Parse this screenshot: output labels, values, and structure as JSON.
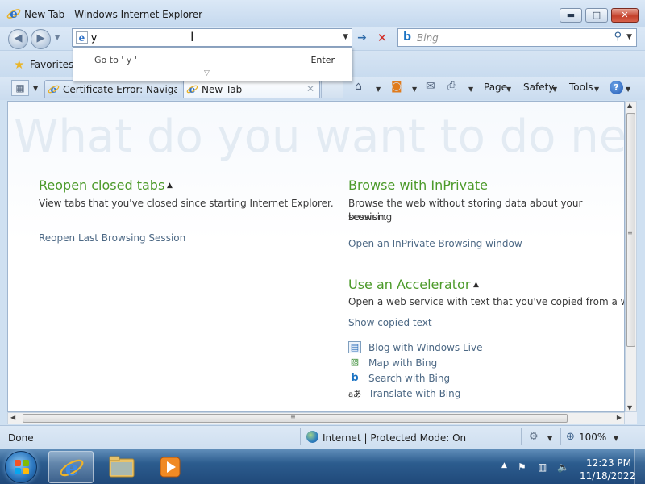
{
  "window": {
    "title": "New Tab - Windows Internet Explorer",
    "minimize_glyph": "▬",
    "maximize_glyph": "□",
    "close_glyph": "✕"
  },
  "navigation": {
    "back_glyph": "◀",
    "forward_glyph": "▶",
    "dropdown_glyph": "▼"
  },
  "address_bar": {
    "value": "y",
    "dropdown_glyph": "▼",
    "go_glyph": "➔",
    "stop_glyph": "✕"
  },
  "autocomplete": {
    "goto_text": "Go to ' y '",
    "enter_label": "Enter",
    "expand_glyph": "▽"
  },
  "search_box": {
    "placeholder": "Bing",
    "provider_glyph": "b",
    "search_glyph": "⚲",
    "dropdown_glyph": "▼"
  },
  "favorites": {
    "label": "Favorites",
    "star_glyph": "★"
  },
  "tabs": [
    {
      "label": "Certificate Error: Navigati...",
      "active": false
    },
    {
      "label": "New Tab",
      "active": true,
      "close_glyph": "✕"
    }
  ],
  "command_bar": {
    "quick_tabs_glyph": "▦",
    "home_glyph": "⌂",
    "feeds_glyph": "◙",
    "mail_glyph": "✉",
    "print_glyph": "⎙",
    "page_label": "Page",
    "safety_label": "Safety",
    "tools_label": "Tools",
    "help_glyph": "?",
    "dropdown_glyph": "▼"
  },
  "new_tab_page": {
    "hero": "What do you want to do next?",
    "reopen": {
      "title": "Reopen closed tabs",
      "toggle_glyph": "▲",
      "description": "View tabs that you've closed since starting Internet Explorer.",
      "link": "Reopen Last Browsing Session"
    },
    "inprivate": {
      "title": "Browse with InPrivate",
      "description_line1": "Browse the web without storing data about your browsing",
      "description_line2": "session.",
      "link": "Open an InPrivate Browsing window"
    },
    "accelerator": {
      "title": "Use an Accelerator",
      "toggle_glyph": "▲",
      "description": "Open a web service with text that you've copied from a we",
      "show_copied_link": "Show copied text",
      "items": [
        {
          "label": "Blog with Windows Live",
          "icon": "blog-icon",
          "glyph": "▤"
        },
        {
          "label": "Map with Bing",
          "icon": "map-icon",
          "glyph": "▧"
        },
        {
          "label": "Search with Bing",
          "icon": "bing-icon",
          "glyph": "b"
        },
        {
          "label": "Translate with Bing",
          "icon": "translate-icon",
          "glyph": "a͟あ"
        }
      ]
    }
  },
  "scrollbars": {
    "up_glyph": "▲",
    "down_glyph": "▼",
    "left_glyph": "◀",
    "right_glyph": "▶",
    "grip_glyph": "≡"
  },
  "status_bar": {
    "status": "Done",
    "zone": "Internet | Protected Mode: On",
    "zoom": "100%",
    "security_glyph": "⚙",
    "zoom_glyph": "⊕",
    "dropdown_glyph": "▼"
  },
  "taskbar": {
    "apps": [
      {
        "name": "internet-explorer",
        "glyph": "e",
        "active": true
      },
      {
        "name": "windows-explorer",
        "glyph": "▆",
        "active": false
      },
      {
        "name": "media-player",
        "glyph": "▶",
        "active": false
      }
    ],
    "tray": {
      "show_hidden_glyph": "▲",
      "flag_glyph": "⚑",
      "network_glyph": "▥",
      "volume_glyph": "🔈",
      "time": "12:23 PM",
      "date": "11/18/2022"
    }
  },
  "colors": {
    "section_title": "#4c9a2a",
    "link": "#4d6985",
    "hero_text": "#e3ebf3",
    "taskbar": "#2c5c8e"
  }
}
